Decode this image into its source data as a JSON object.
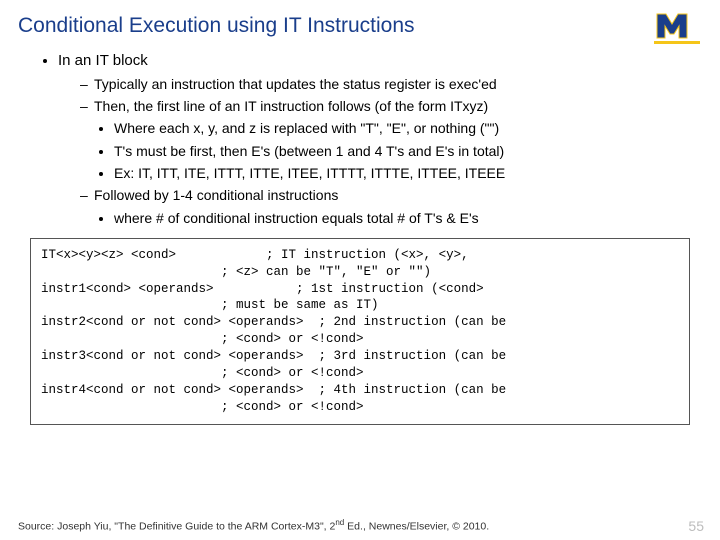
{
  "title": "Conditional Execution using IT Instructions",
  "logo": {
    "name": "umich-block-m"
  },
  "bullets": {
    "l1": "In an IT block",
    "l2a": "Typically an instruction that updates the status register is exec'ed",
    "l2b": "Then, the first line of an IT instruction follows (of the form ITxyz)",
    "l3a": "Where each x, y, and z is replaced with \"T\", \"E\", or nothing (\"\")",
    "l3b": "T's must be first, then E's (between 1 and 4 T's and E's in total)",
    "l3c": "Ex: IT, ITT, ITE, ITTT, ITTE, ITEE, ITTTT, ITTTE, ITTEE, ITEEE",
    "l2c": "Followed by 1-4 conditional instructions",
    "l3d": "where # of conditional instruction equals total # of T's & E's"
  },
  "code": "IT<x><y><z> <cond>            ; IT instruction (<x>, <y>,\n                        ; <z> can be \"T\", \"E\" or \"\")\ninstr1<cond> <operands>           ; 1st instruction (<cond>\n                        ; must be same as IT)\ninstr2<cond or not cond> <operands>  ; 2nd instruction (can be\n                        ; <cond> or <!cond>\ninstr3<cond or not cond> <operands>  ; 3rd instruction (can be\n                        ; <cond> or <!cond>\ninstr4<cond or not cond> <operands>  ; 4th instruction (can be\n                        ; <cond> or <!cond>",
  "source_pre": "Source: Joseph Yiu, \"The Definitive Guide to the ARM Cortex-M3\", 2",
  "source_sup": "nd",
  "source_post": " Ed., Newnes/Elsevier, © 2010.",
  "page": "55"
}
